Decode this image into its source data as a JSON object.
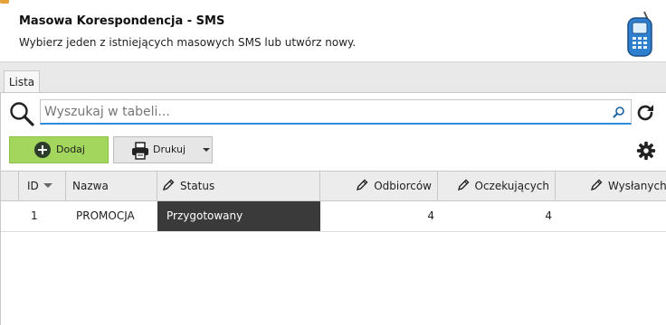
{
  "header": {
    "title": "Masowa Korespondencja - SMS",
    "subtitle": "Wybierz jeden z istniejących masowych SMS lub utwórz nowy."
  },
  "tabs": [
    {
      "label": "Lista",
      "active": true
    }
  ],
  "search": {
    "placeholder": "Wyszukaj w tabeli...",
    "value": ""
  },
  "toolbar": {
    "add_label": "Dodaj",
    "print_label": "Drukuj"
  },
  "table": {
    "columns": [
      {
        "key": "id",
        "label": "ID",
        "editable": false,
        "sorted": "desc"
      },
      {
        "key": "name",
        "label": "Nazwa",
        "editable": false
      },
      {
        "key": "status",
        "label": "Status",
        "editable": true
      },
      {
        "key": "recipients",
        "label": "Odbiorców",
        "editable": true
      },
      {
        "key": "pending",
        "label": "Oczekujących",
        "editable": true
      },
      {
        "key": "sent",
        "label": "Wysłanych",
        "editable": true
      }
    ],
    "rows": [
      {
        "id": "1",
        "name": "PROMOCJA",
        "status": "Przygotowany",
        "recipients": "4",
        "pending": "4",
        "sent": ""
      }
    ]
  },
  "colors": {
    "add_button": "#a3d65c",
    "search_focus": "#2f8bd8",
    "status_cell_bg": "#3a3a3a"
  },
  "icons": [
    "mobile-phone-icon",
    "magnifier-icon",
    "search-icon",
    "refresh-icon",
    "plus-circle-icon",
    "printer-icon",
    "caret-down-icon",
    "gear-icon",
    "pencil-icon",
    "sort-desc-icon"
  ]
}
